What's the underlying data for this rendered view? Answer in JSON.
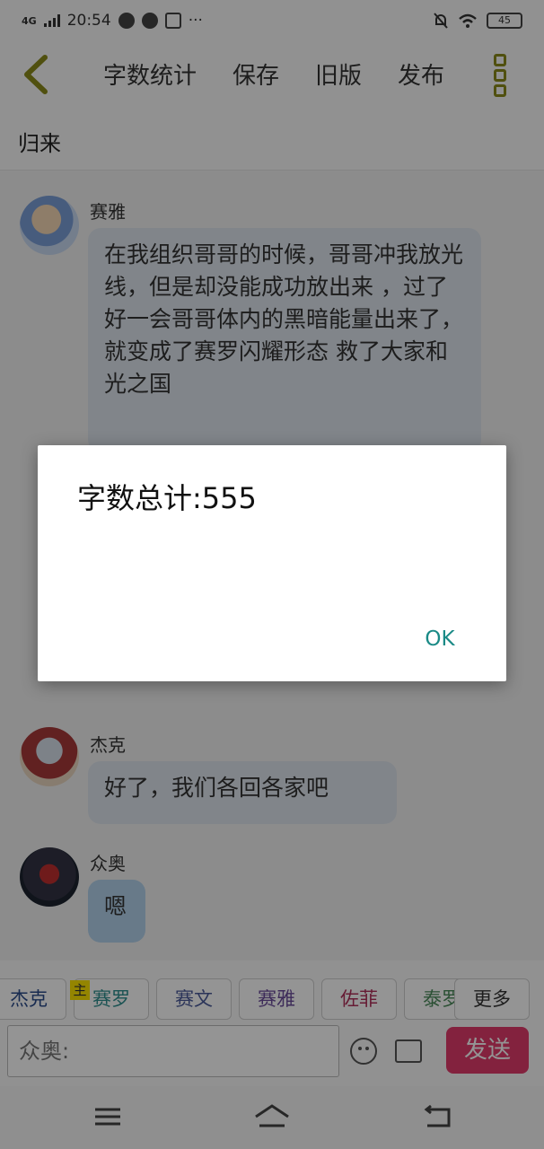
{
  "status_bar": {
    "network": "4G",
    "time": "20:54",
    "dots": "···",
    "battery": "45"
  },
  "toolbar": {
    "word_count_label": "字数统计",
    "save_label": "保存",
    "old_version_label": "旧版",
    "publish_label": "发布"
  },
  "document_title": "归来",
  "messages": [
    {
      "name": "赛雅",
      "text": "在我组织哥哥的时候，哥哥冲我放光线，但是却没能成功放出来 ，过了好一会哥哥体内的黑暗能量出来了，就变成了赛罗闪耀形态 救了大家和光之国"
    },
    {
      "name": "杰克",
      "text": "好了，我们各回各家吧"
    },
    {
      "name": "众奥",
      "text": "嗯"
    }
  ],
  "characters": [
    {
      "label": "杰克",
      "color": "#2a4a8a"
    },
    {
      "label": "赛罗",
      "color": "#2f8f8f",
      "tag": "主"
    },
    {
      "label": "赛文",
      "color": "#4a5a9a"
    },
    {
      "label": "赛雅",
      "color": "#6a4a9a"
    },
    {
      "label": "佐菲",
      "color": "#b0305a"
    },
    {
      "label": "泰罗",
      "color": "#4a8a5a"
    },
    {
      "label": "更多",
      "color": "#333333"
    }
  ],
  "input": {
    "placeholder": "众奥:"
  },
  "send_label": "发送",
  "dialog": {
    "message": "字数总计:555",
    "ok_label": "OK"
  },
  "colors": {
    "accent": "#1a8a86",
    "send": "#e23b6b",
    "bubble": "#dfe6ee",
    "menu_icon": "#8a8a1a"
  }
}
